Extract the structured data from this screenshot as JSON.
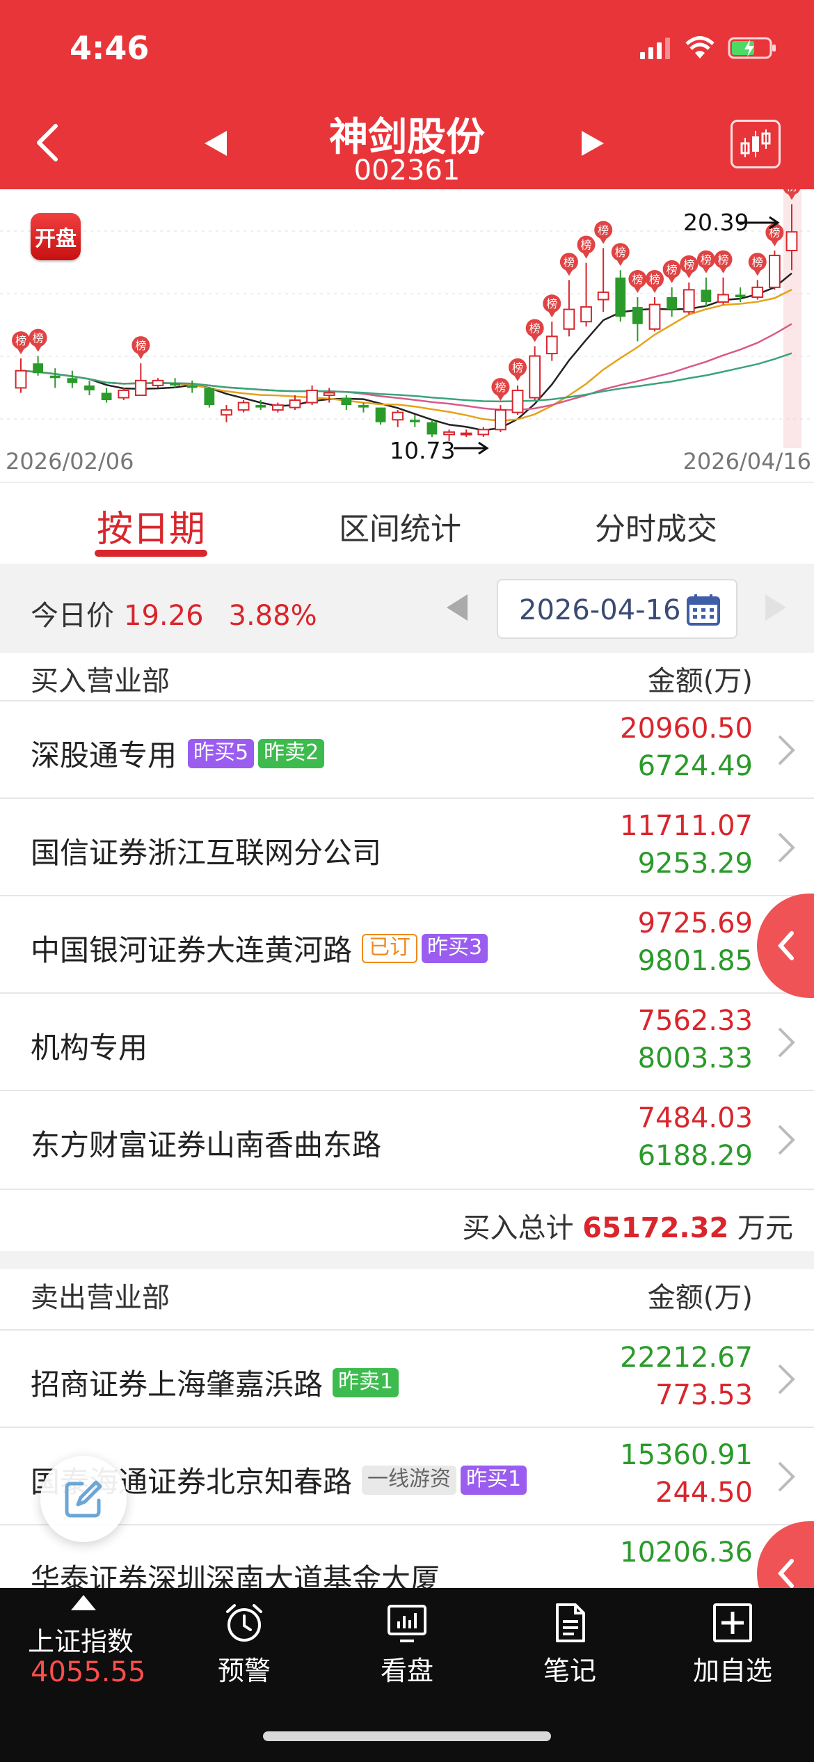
{
  "status": {
    "time": "4:46"
  },
  "header": {
    "stock_name": "神剑股份",
    "stock_code": "002361",
    "back_icon": "chevron-left-icon",
    "prev_icon": "triangle-left-icon",
    "next_icon": "triangle-right-icon",
    "chart_icon": "candlestick-icon"
  },
  "chart": {
    "badge": "开盘",
    "start_date": "2026/02/06",
    "end_date": "2026/04/16",
    "peak_label": "20.39",
    "low_label": "10.73",
    "marker_label": "榜"
  },
  "chart_data": {
    "type": "candlestick",
    "x_start": "2026/02/06",
    "x_end": "2026/04/16",
    "annotations": [
      {
        "label": "20.39",
        "kind": "high"
      },
      {
        "label": "10.73",
        "kind": "low"
      }
    ],
    "marker_text": "榜",
    "candles": [
      {
        "o": 12.9,
        "c": 13.6,
        "h": 14.1,
        "l": 12.7
      },
      {
        "o": 13.9,
        "c": 13.5,
        "h": 14.2,
        "l": 13.4
      },
      {
        "o": 13.4,
        "c": 13.3,
        "h": 13.7,
        "l": 12.9
      },
      {
        "o": 13.3,
        "c": 13.1,
        "h": 13.6,
        "l": 12.9
      },
      {
        "o": 13.0,
        "c": 12.8,
        "h": 13.2,
        "l": 12.6
      },
      {
        "o": 12.7,
        "c": 12.4,
        "h": 12.9,
        "l": 12.3
      },
      {
        "o": 12.5,
        "c": 12.8,
        "h": 12.9,
        "l": 12.4
      },
      {
        "o": 12.6,
        "c": 13.2,
        "h": 13.9,
        "l": 12.6
      },
      {
        "o": 13.0,
        "c": 13.2,
        "h": 13.3,
        "l": 12.9
      },
      {
        "o": 13.1,
        "c": 13.0,
        "h": 13.3,
        "l": 12.9
      },
      {
        "o": 13.0,
        "c": 12.9,
        "h": 13.2,
        "l": 12.7
      },
      {
        "o": 12.9,
        "c": 12.2,
        "h": 12.9,
        "l": 12.1
      },
      {
        "o": 11.8,
        "c": 12.0,
        "h": 12.2,
        "l": 11.5
      },
      {
        "o": 12.0,
        "c": 12.3,
        "h": 12.4,
        "l": 11.9
      },
      {
        "o": 12.2,
        "c": 12.1,
        "h": 12.4,
        "l": 12.0
      },
      {
        "o": 12.0,
        "c": 12.2,
        "h": 12.3,
        "l": 11.9
      },
      {
        "o": 12.1,
        "c": 12.4,
        "h": 12.6,
        "l": 12.0
      },
      {
        "o": 12.3,
        "c": 12.8,
        "h": 13.0,
        "l": 12.2
      },
      {
        "o": 12.6,
        "c": 12.7,
        "h": 12.9,
        "l": 12.3
      },
      {
        "o": 12.5,
        "c": 12.2,
        "h": 12.6,
        "l": 12.0
      },
      {
        "o": 12.2,
        "c": 12.1,
        "h": 12.3,
        "l": 11.9
      },
      {
        "o": 12.1,
        "c": 11.5,
        "h": 12.1,
        "l": 11.4
      },
      {
        "o": 11.6,
        "c": 11.9,
        "h": 12.0,
        "l": 11.3
      },
      {
        "o": 11.6,
        "c": 11.5,
        "h": 11.8,
        "l": 11.3
      },
      {
        "o": 11.5,
        "c": 11.0,
        "h": 11.6,
        "l": 10.9
      },
      {
        "o": 11.0,
        "c": 11.1,
        "h": 11.2,
        "l": 10.73
      },
      {
        "o": 11.0,
        "c": 11.05,
        "h": 11.2,
        "l": 10.9
      },
      {
        "o": 11.0,
        "c": 11.2,
        "h": 11.3,
        "l": 10.9
      },
      {
        "o": 11.2,
        "c": 12.0,
        "h": 12.2,
        "l": 11.1
      },
      {
        "o": 11.9,
        "c": 12.8,
        "h": 13.0,
        "l": 11.8
      },
      {
        "o": 12.5,
        "c": 14.2,
        "h": 14.6,
        "l": 12.4
      },
      {
        "o": 14.3,
        "c": 15.0,
        "h": 15.6,
        "l": 14.0
      },
      {
        "o": 15.3,
        "c": 16.1,
        "h": 17.3,
        "l": 15.0
      },
      {
        "o": 15.6,
        "c": 16.2,
        "h": 18.0,
        "l": 15.4
      },
      {
        "o": 16.5,
        "c": 16.8,
        "h": 18.6,
        "l": 16.0
      },
      {
        "o": 17.4,
        "c": 15.8,
        "h": 17.7,
        "l": 15.6
      },
      {
        "o": 16.2,
        "c": 15.5,
        "h": 16.6,
        "l": 14.8
      },
      {
        "o": 15.3,
        "c": 16.3,
        "h": 16.6,
        "l": 15.2
      },
      {
        "o": 16.6,
        "c": 16.1,
        "h": 17.0,
        "l": 15.8
      },
      {
        "o": 16.0,
        "c": 16.9,
        "h": 17.2,
        "l": 15.9
      },
      {
        "o": 16.9,
        "c": 16.4,
        "h": 17.4,
        "l": 16.2
      },
      {
        "o": 16.4,
        "c": 16.7,
        "h": 17.4,
        "l": 16.3
      },
      {
        "o": 16.7,
        "c": 16.6,
        "h": 17.0,
        "l": 16.4
      },
      {
        "o": 16.6,
        "c": 17.0,
        "h": 17.3,
        "l": 16.5
      },
      {
        "o": 17.0,
        "c": 18.3,
        "h": 18.5,
        "l": 16.9
      },
      {
        "o": 18.5,
        "c": 19.26,
        "h": 20.39,
        "l": 17.7
      }
    ],
    "marker_indices": [
      0,
      1,
      7,
      28,
      29,
      30,
      31,
      32,
      33,
      34,
      35,
      36,
      37,
      38,
      39,
      40,
      41,
      43,
      44,
      45
    ]
  },
  "tabs": [
    {
      "label": "按日期",
      "active": true
    },
    {
      "label": "区间统计",
      "active": false
    },
    {
      "label": "分时成交",
      "active": false
    }
  ],
  "pricebar": {
    "label": "今日价",
    "price": "19.26",
    "change": "3.88%",
    "date": "2026-04-16"
  },
  "buy": {
    "title": "买入营业部",
    "unit": "金额(万)",
    "rows": [
      {
        "name": "深股通专用",
        "tags": [
          {
            "text": "昨买5",
            "style": "purple"
          },
          {
            "text": "昨卖2",
            "style": "green"
          }
        ],
        "buy": "20960.50",
        "sell": "6724.49"
      },
      {
        "name": "国信证券浙江互联网分公司",
        "tags": [],
        "buy": "11711.07",
        "sell": "9253.29"
      },
      {
        "name": "中国银河证券大连黄河路",
        "tags": [
          {
            "text": "已订",
            "style": "orange"
          },
          {
            "text": "昨买3",
            "style": "purple"
          }
        ],
        "buy": "9725.69",
        "sell": "9801.85"
      },
      {
        "name": "机构专用",
        "tags": [],
        "buy": "7562.33",
        "sell": "8003.33"
      },
      {
        "name": "东方财富证券山南香曲东路",
        "tags": [],
        "buy": "7484.03",
        "sell": "6188.29"
      }
    ],
    "total_label": "买入总计",
    "total_value": "65172.32",
    "total_unit": "万元"
  },
  "sell": {
    "title": "卖出营业部",
    "unit": "金额(万)",
    "rows": [
      {
        "name": "招商证券上海肇嘉浜路",
        "tags": [
          {
            "text": "昨卖1",
            "style": "green"
          }
        ],
        "sell": "22212.67",
        "buy": "773.53"
      },
      {
        "name": "国泰海通证券北京知春路",
        "tags": [
          {
            "text": "一线游资",
            "style": "gray"
          },
          {
            "text": "昨买1",
            "style": "purple"
          }
        ],
        "sell": "15360.91",
        "buy": "244.50"
      },
      {
        "name": "华泰证券深圳深南大道基金大厦",
        "tags": [],
        "sell": "10206.36",
        "buy": ""
      }
    ]
  },
  "colors": {
    "brand_red": "#e8353a",
    "up_red": "#d9252c",
    "down_green": "#2a9a2a",
    "tag_purple": "#9a5df0",
    "tag_green": "#3dbb4e"
  },
  "bottombar": {
    "index_label": "上证指数",
    "index_value": "4055.55",
    "items": [
      {
        "label": "预警",
        "icon": "alarm-clock-icon"
      },
      {
        "label": "看盘",
        "icon": "monitor-chart-icon"
      },
      {
        "label": "笔记",
        "icon": "note-icon"
      },
      {
        "label": "加自选",
        "icon": "plus-square-icon"
      }
    ]
  }
}
